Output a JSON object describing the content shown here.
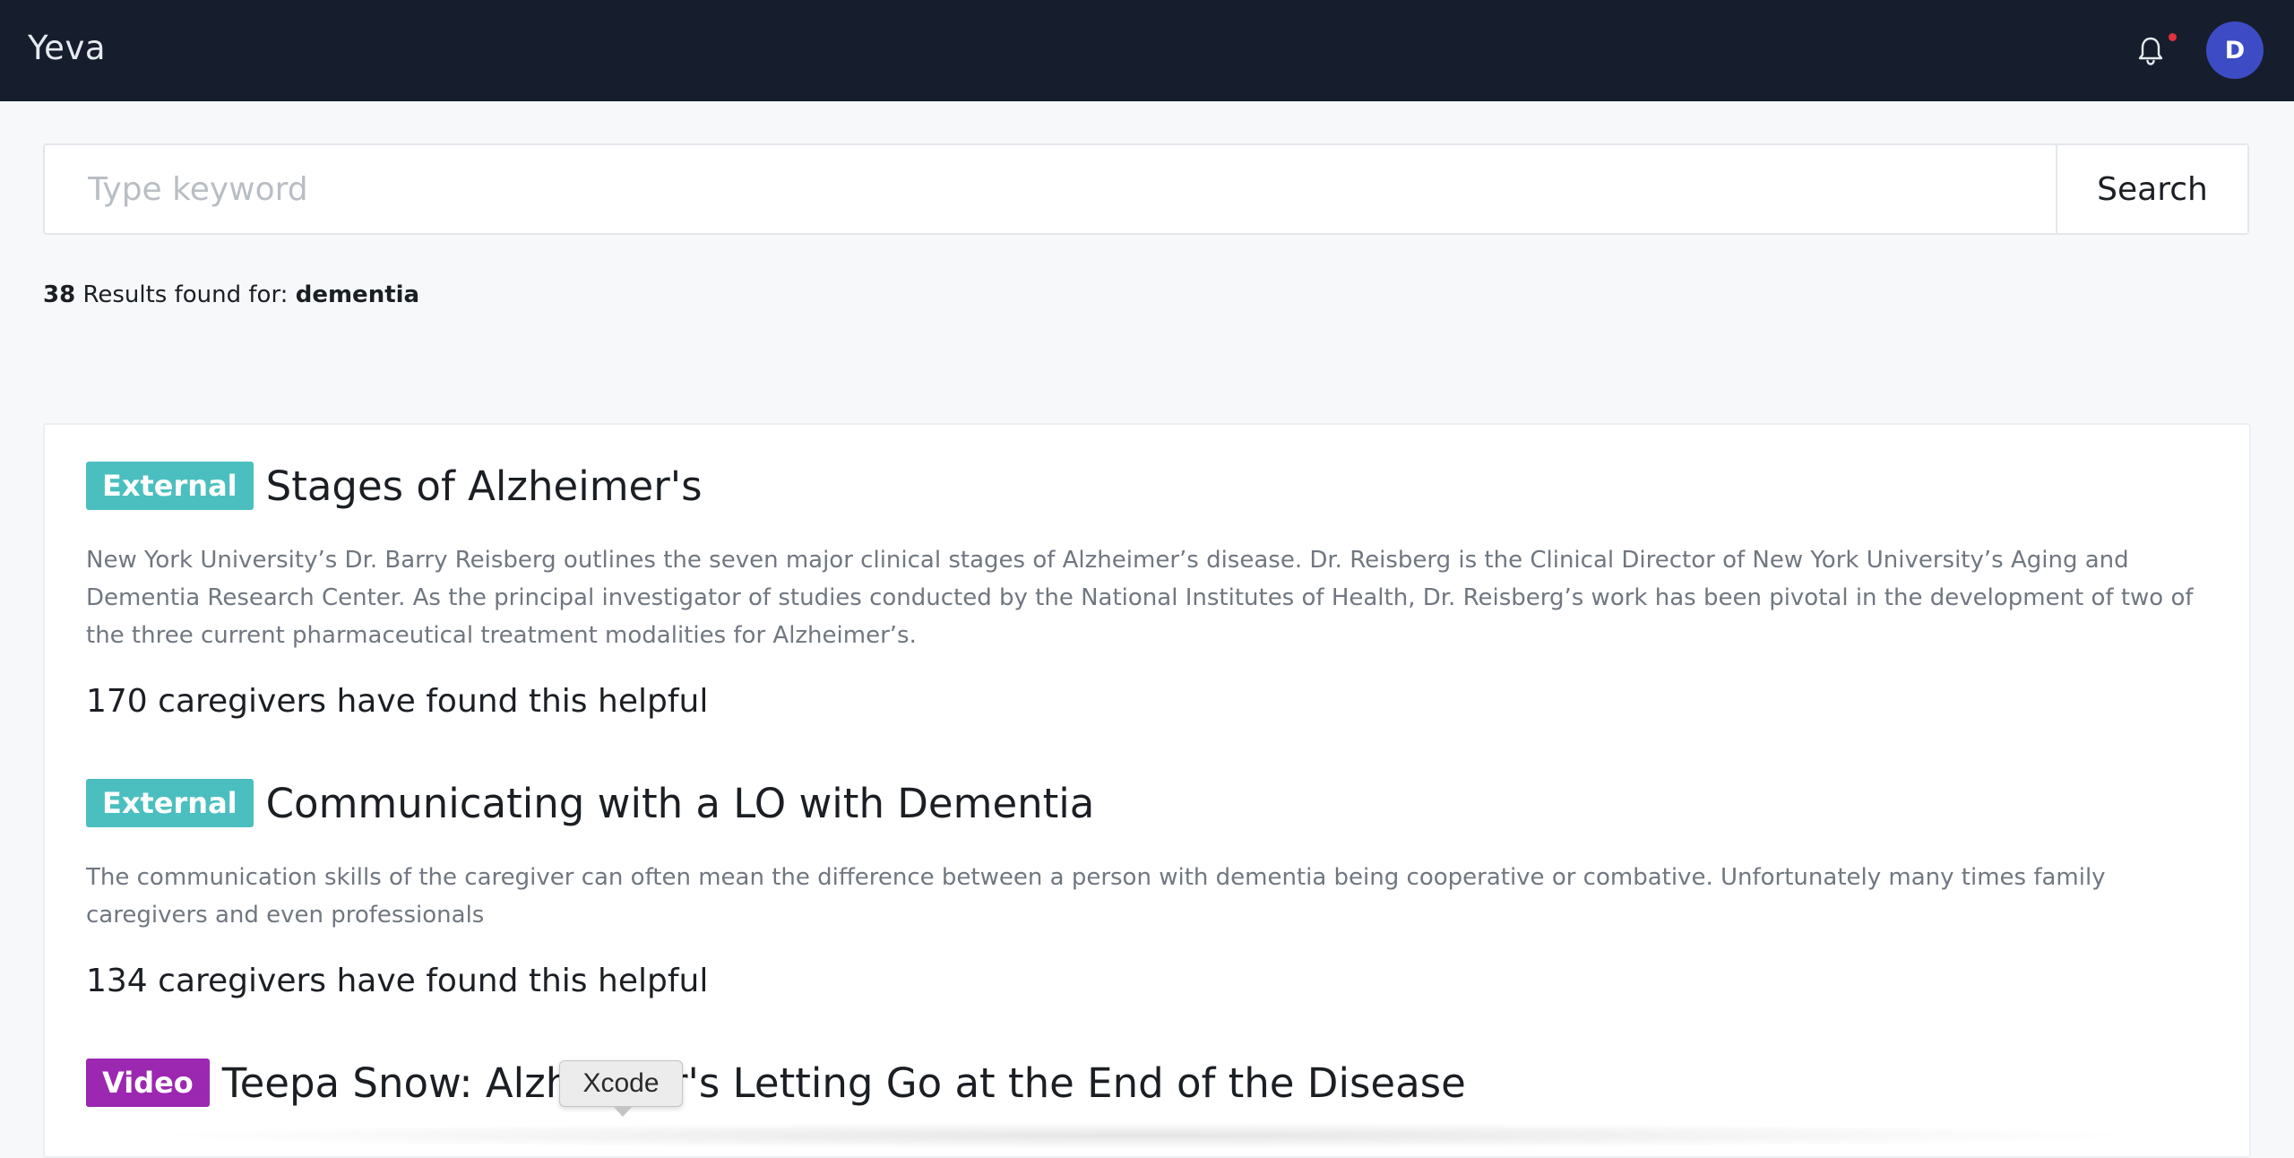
{
  "header": {
    "brand": "Yeva",
    "bell_icon": "bell-icon",
    "has_notification_dot": true,
    "avatar_initial": "D",
    "colors": {
      "bar": "#161e2e",
      "avatar": "#3d4cc4",
      "dot": "#e0323c"
    }
  },
  "search": {
    "placeholder": "Type keyword",
    "value": "",
    "button_label": "Search"
  },
  "results": {
    "count": "38",
    "label": "Results found for:",
    "query": "dementia"
  },
  "items": [
    {
      "badge": "External",
      "badge_color": "#4bbfbf",
      "title": "Stages of Alzheimer's",
      "description": "New York University’s Dr. Barry Reisberg outlines the seven major clinical stages of Alzheimer’s disease. Dr. Reisberg is the Clinical Director of New York University’s Aging and Dementia Research Center. As the principal investigator of studies conducted by the National Institutes of Health, Dr. Reisberg’s work has been pivotal in the development of two of the three current pharmaceutical treatment modalities for Alzheimer’s.",
      "helpful": "170 caregivers have found this helpful"
    },
    {
      "badge": "External",
      "badge_color": "#4bbfbf",
      "title": "Communicating with a LO with Dementia",
      "description": "The communication skills of the caregiver can often mean the difference between a person with dementia being cooperative or combative. Unfortunately many times family caregivers and even professionals",
      "helpful": "134 caregivers have found this helpful"
    },
    {
      "badge": "Video",
      "badge_color": "#9c27b0",
      "title": "Teepa Snow: Alzheimer's Letting Go at the End of the Disease"
    }
  ],
  "tooltip": {
    "label": "Xcode"
  }
}
